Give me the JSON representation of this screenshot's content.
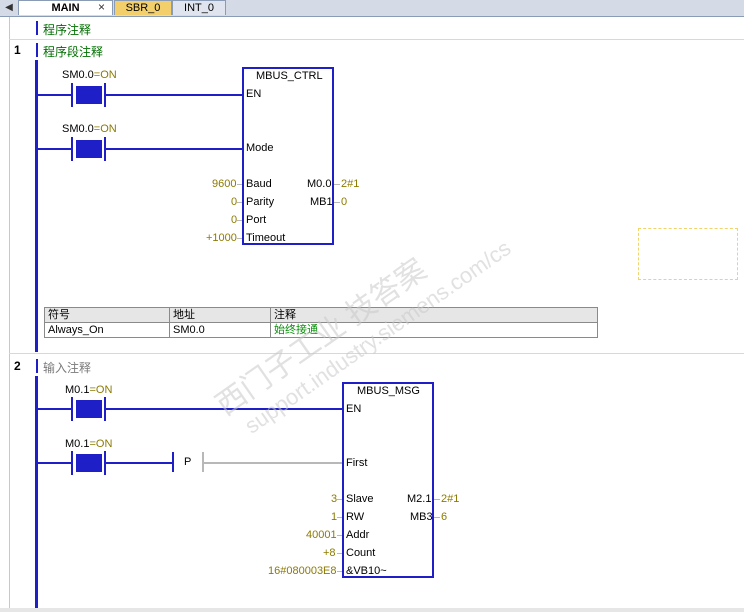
{
  "tabs": [
    {
      "label": "MAIN",
      "active": true
    },
    {
      "label": "SBR_0",
      "active": false
    },
    {
      "label": "INT_0",
      "active": false
    }
  ],
  "tab_close_icon": "×",
  "program_comment": "程序注释",
  "network1": {
    "number": "1",
    "comment": "程序段注释",
    "contact1": {
      "address": "SM0.0",
      "state": "=ON"
    },
    "contact2": {
      "address": "SM0.0",
      "state": "=ON"
    },
    "box": {
      "title": "MBUS_CTRL",
      "inputs": {
        "en": "EN",
        "mode": "Mode",
        "baud": "Baud",
        "parity": "Parity",
        "port": "Port",
        "timeout": "Timeout"
      },
      "input_values": {
        "baud": "9600",
        "parity": "0",
        "port": "0",
        "timeout": "+1000"
      },
      "outputs": {
        "done": "M0.0",
        "error": "MB1"
      },
      "output_values": {
        "done": "2#1",
        "error": "0"
      }
    },
    "symbol_table": {
      "headers": {
        "symbol": "符号",
        "address": "地址",
        "comment": "注释"
      },
      "row": {
        "symbol": "Always_On",
        "address": "SM0.0",
        "comment": "始终接通"
      }
    }
  },
  "network2": {
    "number": "2",
    "comment": "输入注释",
    "contact1": {
      "address": "M0.1",
      "state": "=ON"
    },
    "contact2": {
      "address": "M0.1",
      "state": "=ON"
    },
    "edge_contact": "P",
    "box": {
      "title": "MBUS_MSG",
      "inputs": {
        "en": "EN",
        "first": "First",
        "slave": "Slave",
        "rw": "RW",
        "addr": "Addr",
        "count": "Count",
        "dataptr": "&VB10~"
      },
      "input_values": {
        "slave": "3",
        "rw": "1",
        "addr": "40001",
        "count": "+8",
        "dataptr": "16#080003E8"
      },
      "outputs": {
        "done": "M2.1",
        "error": "MB3"
      },
      "output_values": {
        "done": "2#1",
        "error": "6"
      }
    }
  },
  "watermark": {
    "line1": "西门子工业  技答案",
    "line2": "support.industry.siemens.com/cs"
  },
  "colors": {
    "wire": "#1f1fc8",
    "comment": "#006e00",
    "value": "#8c7a00"
  }
}
